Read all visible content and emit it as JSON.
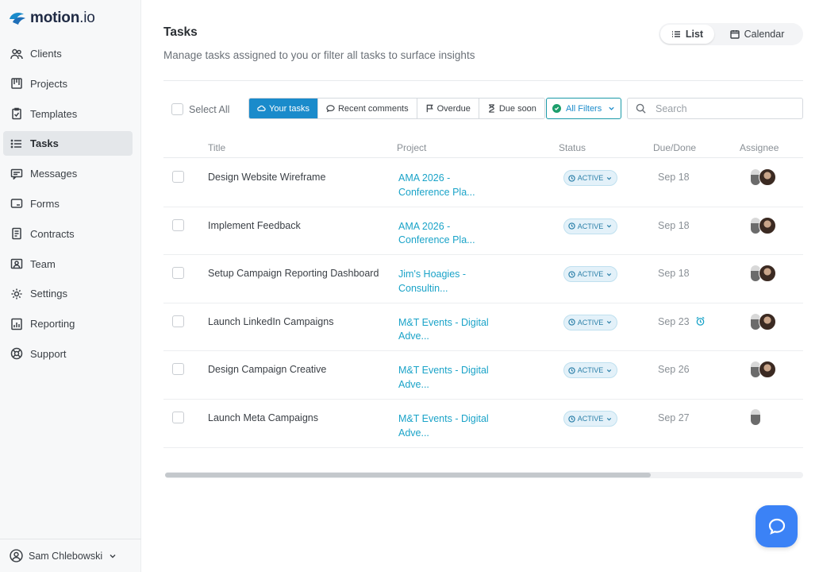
{
  "brand": {
    "name": "motion",
    "suffix": ".io"
  },
  "sidebar": {
    "items": [
      {
        "label": "Clients",
        "icon": "users-icon"
      },
      {
        "label": "Projects",
        "icon": "projects-icon"
      },
      {
        "label": "Templates",
        "icon": "clipboard-icon"
      },
      {
        "label": "Tasks",
        "icon": "list-icon",
        "active": true
      },
      {
        "label": "Messages",
        "icon": "messages-icon"
      },
      {
        "label": "Forms",
        "icon": "forms-icon"
      },
      {
        "label": "Contracts",
        "icon": "contract-icon"
      },
      {
        "label": "Team",
        "icon": "team-icon"
      },
      {
        "label": "Settings",
        "icon": "gear-icon"
      },
      {
        "label": "Reporting",
        "icon": "chart-icon"
      },
      {
        "label": "Support",
        "icon": "lifebuoy-icon"
      }
    ],
    "user": "Sam Chlebowski"
  },
  "header": {
    "title": "Tasks",
    "subtitle": "Manage tasks assigned to you or filter all tasks to surface insights",
    "views": {
      "list": "List",
      "calendar": "Calendar",
      "active": "list"
    }
  },
  "toolbar": {
    "select_all": "Select All",
    "segments": [
      {
        "label": "Your tasks",
        "icon": "cloud-icon",
        "active": true
      },
      {
        "label": "Recent comments",
        "icon": "comment-icon"
      },
      {
        "label": "Overdue",
        "icon": "flag-icon"
      },
      {
        "label": "Due soon",
        "icon": "hourglass-icon"
      }
    ],
    "filters": "All Filters",
    "search_placeholder": "Search"
  },
  "table": {
    "columns": {
      "title": "Title",
      "project": "Project",
      "status": "Status",
      "due": "Due/Done",
      "assignee": "Assignee"
    },
    "rows": [
      {
        "title": "Design Website Wireframe",
        "project_1": "AMA 2026 -",
        "project_2": "Conference Pla...",
        "status": "ACTIVE",
        "due": "Sep 18",
        "alarm": false,
        "assignees": 2
      },
      {
        "title": "Implement Feedback",
        "project_1": "AMA 2026 -",
        "project_2": "Conference Pla...",
        "status": "ACTIVE",
        "due": "Sep 18",
        "alarm": false,
        "assignees": 2
      },
      {
        "title": "Setup Campaign Reporting Dashboard",
        "project_1": "Jim's Hoagies -",
        "project_2": "Consultin...",
        "status": "ACTIVE",
        "due": "Sep 18",
        "alarm": false,
        "assignees": 2
      },
      {
        "title": "Launch LinkedIn Campaigns",
        "project_1": "M&T Events - Digital",
        "project_2": "Adve...",
        "status": "ACTIVE",
        "due": "Sep 23",
        "alarm": true,
        "assignees": 2
      },
      {
        "title": "Design Campaign Creative",
        "project_1": "M&T Events - Digital",
        "project_2": "Adve...",
        "status": "ACTIVE",
        "due": "Sep 26",
        "alarm": false,
        "assignees": 2
      },
      {
        "title": "Launch Meta Campaigns",
        "project_1": "M&T Events - Digital",
        "project_2": "Adve...",
        "status": "ACTIVE",
        "due": "Sep 27",
        "alarm": false,
        "assignees": 1
      }
    ]
  },
  "colors": {
    "accent": "#1a8bcb",
    "link": "#1aa3c8",
    "status_bg": "#e3f1f9",
    "chat": "#3b82f6"
  }
}
